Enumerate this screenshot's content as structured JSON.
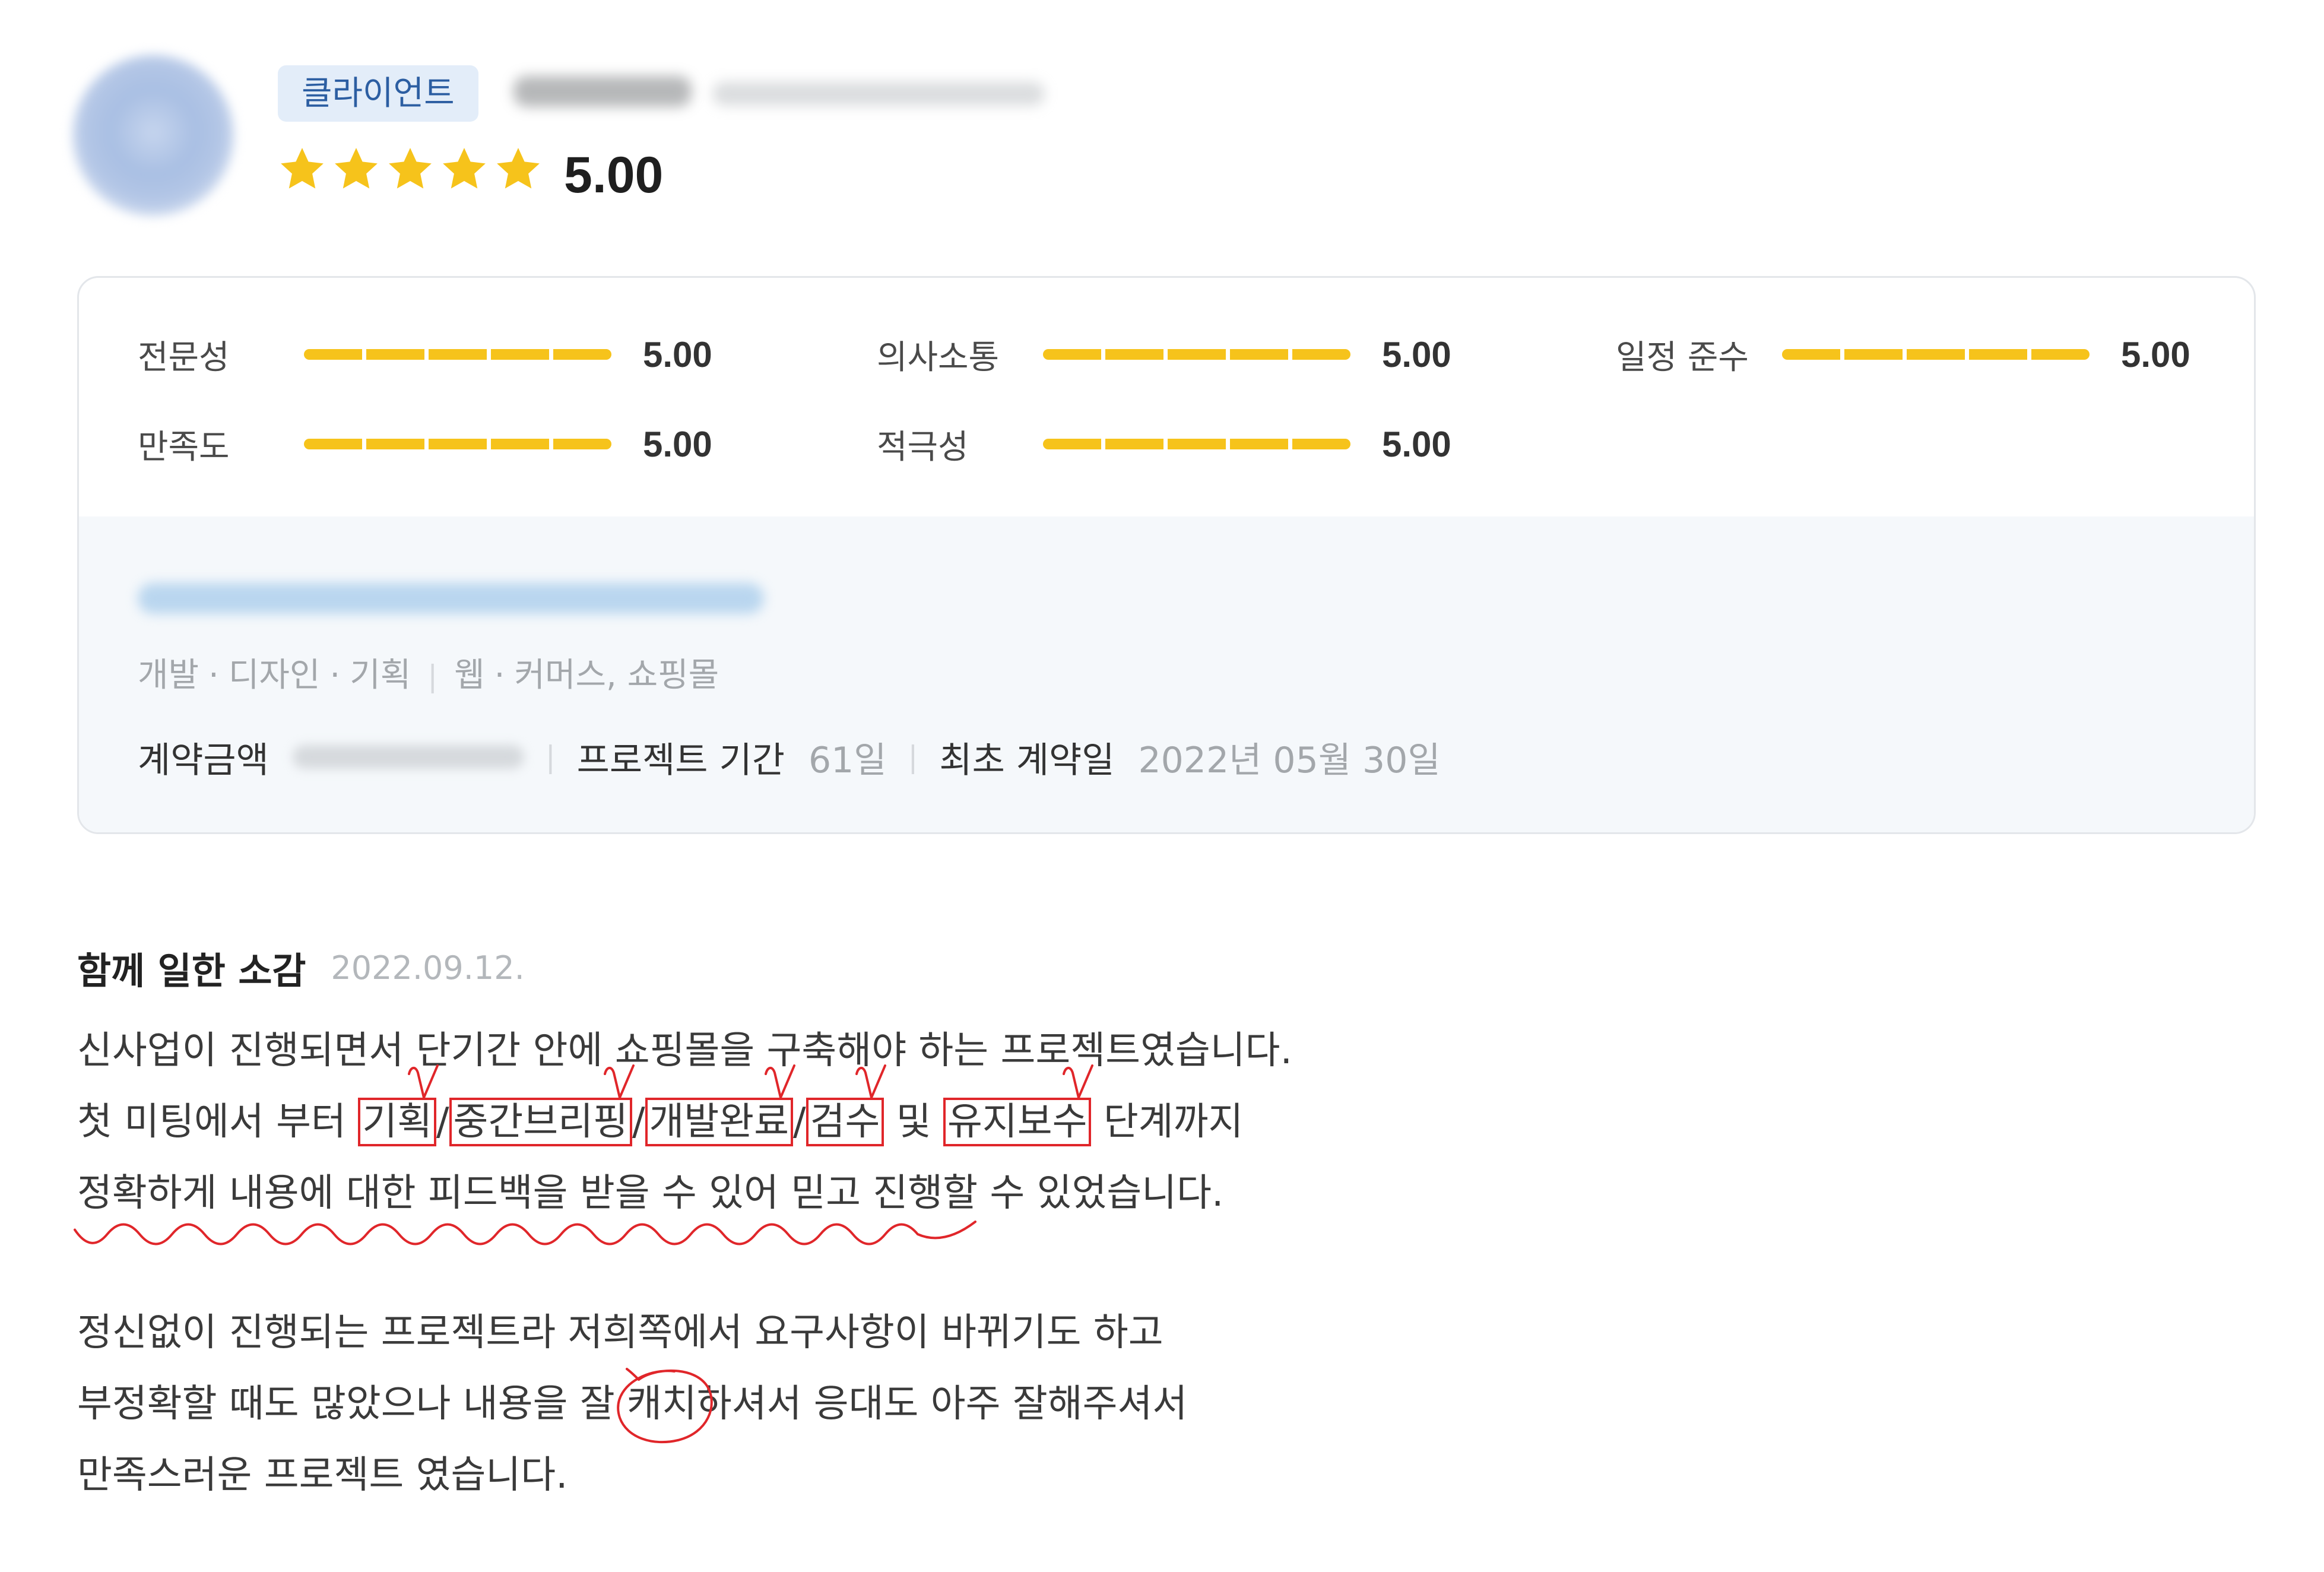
{
  "reviewer": {
    "role_badge": "클라이언트",
    "stars_filled": 5,
    "rating": "5.00"
  },
  "scores": [
    {
      "label": "전문성",
      "value": "5.00",
      "fill": 1
    },
    {
      "label": "의사소통",
      "value": "5.00",
      "fill": 1
    },
    {
      "label": "일정 준수",
      "value": "5.00",
      "fill": 1
    },
    {
      "label": "만족도",
      "value": "5.00",
      "fill": 1
    },
    {
      "label": "적극성",
      "value": "5.00",
      "fill": 1
    }
  ],
  "project": {
    "fields": [
      "개발",
      "디자인",
      "기획"
    ],
    "industries": [
      "웹",
      "커머스, 쇼핑몰"
    ],
    "dot": "·",
    "divider": "|",
    "contract_amount_label": "계약금액",
    "period_label": "프로젝트 기간",
    "period_value": "61일",
    "first_contract_label": "최초 계약일",
    "first_contract_value": "2022년 05월 30일"
  },
  "review": {
    "heading": "함께 일한 소감",
    "date": "2022.09.12.",
    "paragraph_1": {
      "line_1": "신사업이 진행되면서 단기간 안에 쇼핑몰을 구축해야 하는 프로젝트였습니다.",
      "line_2": {
        "lead": "첫 미팅에서 부터 ",
        "stage_1": "기획",
        "slash": "/",
        "stage_2": "중간브리핑",
        "stage_3": "개발완료",
        "stage_4": "검수",
        "conj": " 및 ",
        "stage_5": "유지보수",
        "tail": " 단계까지"
      },
      "line_3": {
        "underlined": "정확하게 내용에 대한 피드백을 받을 수 있어 믿고 진행할",
        "rest": " 수 있었습니다."
      }
    },
    "paragraph_2": {
      "line_1": "정신없이 진행되는 프로젝트라 저희쪽에서 요구사항이 바뀌기도 하고",
      "line_2": {
        "before": "부정확할 때도 많았으나 내용을 잘 ",
        "circled": "캐치",
        "after": "하셔서 응대도 아주 잘해주셔서"
      },
      "line_3": "만족스러운 프로젝트 였습니다."
    }
  },
  "colors": {
    "accent": "#f6c31b",
    "annotation": "#e0262a",
    "badge_bg": "#e3edf9",
    "badge_text": "#2c5ea2"
  }
}
